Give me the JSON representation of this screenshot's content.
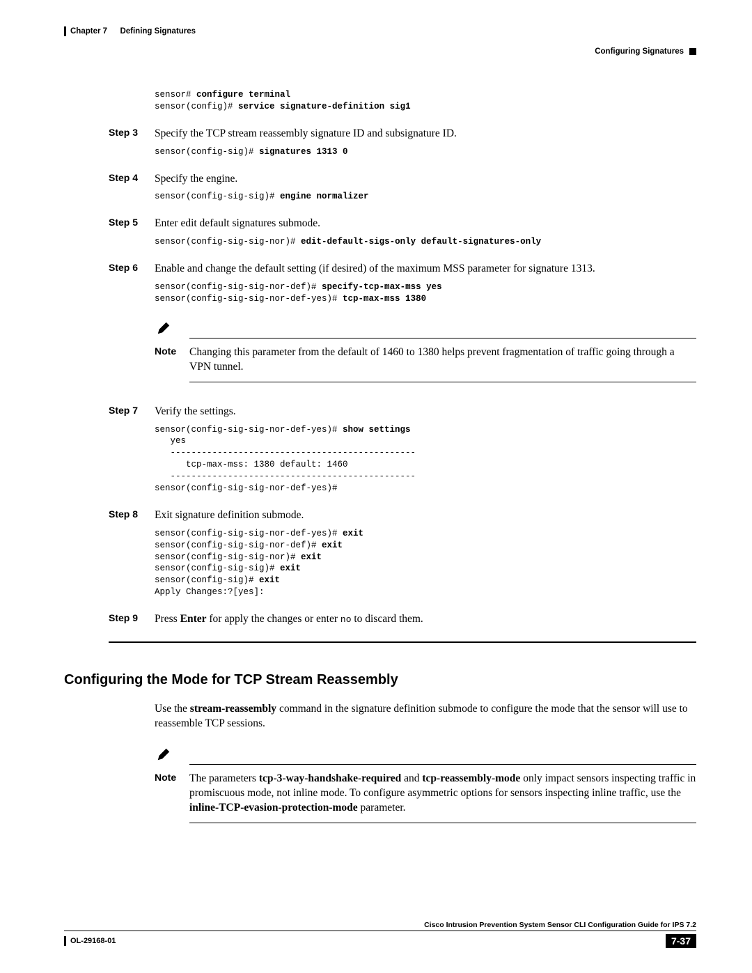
{
  "header": {
    "chapter": "Chapter 7",
    "title": "Defining Signatures",
    "subtitle": "Configuring Signatures"
  },
  "precode": {
    "p1": "sensor# ",
    "b1": "configure terminal",
    "p2": "sensor(config)# ",
    "b2": "service signature-definition sig1"
  },
  "steps": {
    "s3": {
      "label": "Step 3",
      "text": "Specify the TCP stream reassembly signature ID and subsignature ID.",
      "cp1": "sensor(config-sig)# ",
      "cb1": "signatures 1313 0"
    },
    "s4": {
      "label": "Step 4",
      "text": "Specify the engine.",
      "cp1": "sensor(config-sig-sig)# ",
      "cb1": "engine normalizer"
    },
    "s5": {
      "label": "Step 5",
      "text": "Enter edit default signatures submode.",
      "cp1": "sensor(config-sig-sig-nor)# ",
      "cb1": "edit-default-sigs-only default-signatures-only"
    },
    "s6": {
      "label": "Step 6",
      "text": "Enable and change the default setting (if desired) of the maximum MSS parameter for signature 1313.",
      "cp1": "sensor(config-sig-sig-nor-def)# ",
      "cb1": "specify-tcp-max-mss yes",
      "cp2": "sensor(config-sig-sig-nor-def-yes)# ",
      "cb2": "tcp-max-mss 1380"
    },
    "note1": {
      "label": "Note",
      "text": "Changing this parameter from the default of 1460 to 1380 helps prevent fragmentation of traffic going through a VPN tunnel."
    },
    "s7": {
      "label": "Step 7",
      "text": "Verify the settings.",
      "cp1": "sensor(config-sig-sig-nor-def-yes)# ",
      "cb1": "show settings",
      "cplain": "   yes\n   -----------------------------------------------\n      tcp-max-mss: 1380 default: 1460\n   -----------------------------------------------\nsensor(config-sig-sig-nor-def-yes)#"
    },
    "s8": {
      "label": "Step 8",
      "text": "Exit signature definition submode.",
      "l1a": "sensor(config-sig-sig-nor-def-yes)# ",
      "l1b": "exit",
      "l2a": "sensor(config-sig-sig-nor-def)# ",
      "l2b": "exit",
      "l3a": "sensor(config-sig-sig-nor)# ",
      "l3b": "exit",
      "l4a": "sensor(config-sig-sig)# ",
      "l4b": "exit",
      "l5a": "sensor(config-sig)# ",
      "l5b": "exit",
      "l6": "Apply Changes:?[yes]:"
    },
    "s9": {
      "label": "Step 9",
      "t1": "Press ",
      "b1": "Enter",
      "t2": " for apply the changes or enter ",
      "m1": "no",
      "t3": " to discard them."
    }
  },
  "section2": {
    "heading": "Configuring the Mode for TCP Stream Reassembly",
    "p1a": "Use the ",
    "p1b": "stream-reassembly",
    "p1c": " command in the signature definition submode to configure the mode that the sensor will use to reassemble TCP sessions.",
    "note": {
      "label": "Note",
      "t1": "The parameters ",
      "b1": "tcp-3-way-handshake-required",
      "t2": " and ",
      "b2": "tcp-reassembly-mode",
      "t3": " only impact sensors inspecting traffic in promiscuous mode, not inline mode. To configure asymmetric options for sensors inspecting inline traffic, use the ",
      "b3": "inline-TCP-evasion-protection-mode",
      "t4": " parameter."
    }
  },
  "footer": {
    "title": "Cisco Intrusion Prevention System Sensor CLI Configuration Guide for IPS 7.2",
    "docid": "OL-29168-01",
    "page": "7-37"
  }
}
